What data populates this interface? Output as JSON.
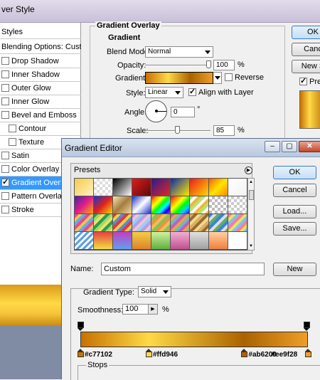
{
  "layer_style": {
    "title": "ver Style",
    "list": [
      {
        "label": "Styles",
        "checkbox": false
      },
      {
        "label": "Blending Options: Custom",
        "checkbox": false
      },
      {
        "label": "Drop Shadow",
        "checkbox": true,
        "checked": false
      },
      {
        "label": "Inner Shadow",
        "checkbox": true,
        "checked": false
      },
      {
        "label": "Outer Glow",
        "checkbox": true,
        "checked": false
      },
      {
        "label": "Inner Glow",
        "checkbox": true,
        "checked": false
      },
      {
        "label": "Bevel and Emboss",
        "checkbox": true,
        "checked": false
      },
      {
        "label": "Contour",
        "checkbox": true,
        "checked": false
      },
      {
        "label": "Texture",
        "checkbox": true,
        "checked": false
      },
      {
        "label": "Satin",
        "checkbox": true,
        "checked": false
      },
      {
        "label": "Color Overlay",
        "checkbox": true,
        "checked": false
      },
      {
        "label": "Gradient Overlay",
        "checkbox": true,
        "checked": true
      },
      {
        "label": "Pattern Overlay",
        "checkbox": true,
        "checked": false
      },
      {
        "label": "Stroke",
        "checkbox": true,
        "checked": false
      }
    ],
    "section_title": "Gradient Overlay",
    "sub_title": "Gradient",
    "blend_mode_label": "Blend Mode:",
    "blend_mode_value": "Normal",
    "opacity_label": "Opacity:",
    "opacity_value": "100",
    "opacity_unit": "%",
    "opacity_fraction": 1.0,
    "gradient_label": "Gradient:",
    "reverse_label": "Reverse",
    "style_label": "Style:",
    "style_value": "Linear",
    "align_label": "Align with Layer",
    "angle_label": "Angle:",
    "angle_value": "0",
    "angle_unit": "°",
    "scale_label": "Scale:",
    "scale_value": "85",
    "scale_unit": "%",
    "ok_label": "OK",
    "cancel_label": "Canc",
    "new_style_label": "New S",
    "preview_label": "Pre"
  },
  "gradient_editor": {
    "title": "Gradient Editor",
    "presets_label": "Presets",
    "ok_label": "OK",
    "cancel_label": "Cancel",
    "load_label": "Load...",
    "save_label": "Save...",
    "name_label": "Name:",
    "name_value": "Custom",
    "new_label": "New",
    "gradient_type_label": "Gradient Type:",
    "gradient_type_value": "Solid",
    "smoothness_label": "Smoothness:",
    "smoothness_value": "100",
    "smoothness_unit": "%",
    "stops_label": "Stops",
    "color_stops": [
      {
        "hex": "#c77102",
        "label": "#c77102",
        "position": 0.0
      },
      {
        "hex": "#ffd946",
        "label": "#ffd946",
        "position": 0.3
      },
      {
        "hex": "#ab6200",
        "label": "#ab6200",
        "position": 0.72
      },
      {
        "hex": "#ee9f28",
        "label": "#ee9f28",
        "position": 1.0
      }
    ]
  }
}
